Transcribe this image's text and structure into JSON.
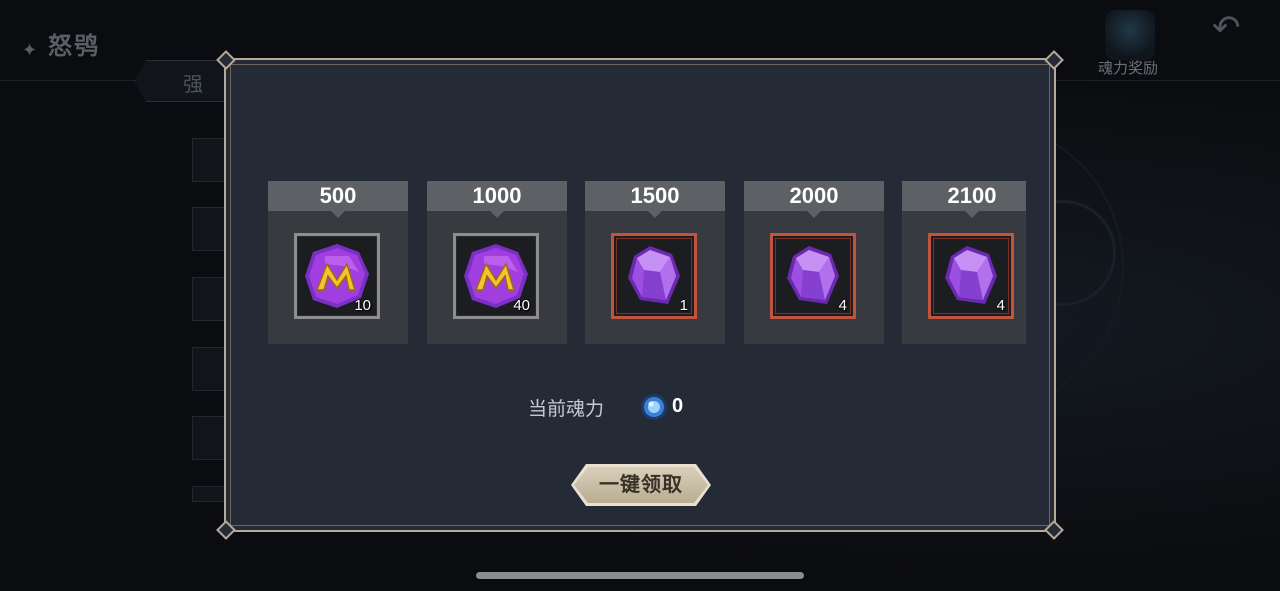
{
  "background": {
    "title": "怒鸮",
    "tab_label": "强 化",
    "reward_label": "魂力奖励"
  },
  "rewards": [
    {
      "threshold": "500",
      "quantity": "10",
      "icon": "m-rune-gem-icon",
      "frame": "gray"
    },
    {
      "threshold": "1000",
      "quantity": "40",
      "icon": "m-rune-gem-icon",
      "frame": "gray"
    },
    {
      "threshold": "1500",
      "quantity": "1",
      "icon": "purple-crystal-icon",
      "frame": "red"
    },
    {
      "threshold": "2000",
      "quantity": "4",
      "icon": "purple-crystal-icon",
      "frame": "red"
    },
    {
      "threshold": "2100",
      "quantity": "4",
      "icon": "purple-crystal-icon",
      "frame": "red"
    }
  ],
  "soul_power": {
    "label": "当前魂力",
    "value": "0",
    "icon": "soul-orb-icon"
  },
  "claim_button": {
    "label": "一键领取"
  },
  "colors": {
    "modal_bg": "#242a36",
    "modal_border": "#b7ab97",
    "card_header": "#5d6064",
    "card_body": "#373a3e",
    "legendary_frame": "#c2533c",
    "common_frame": "#8e8e8e",
    "button": "#c9bea6"
  }
}
